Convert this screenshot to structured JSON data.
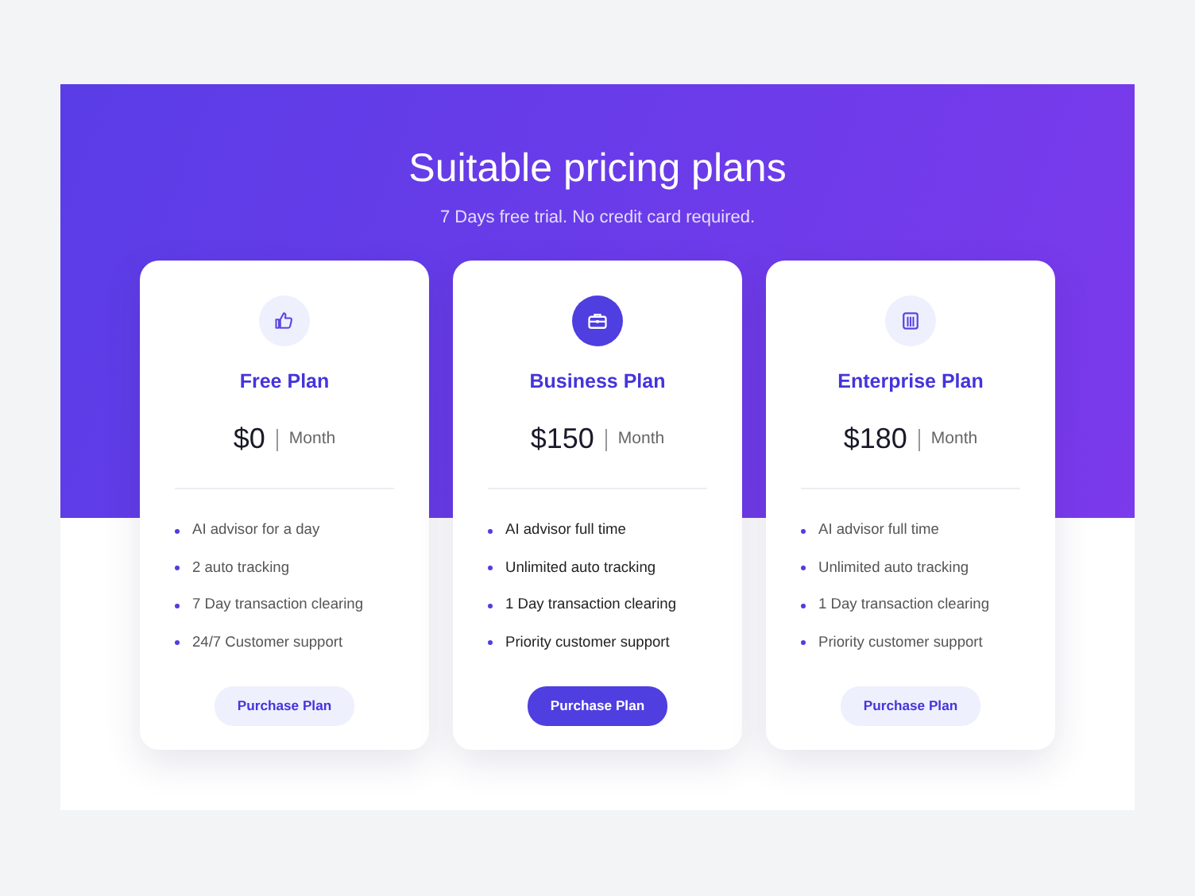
{
  "header": {
    "title": "Suitable pricing plans",
    "subtitle": "7 Days free trial. No credit card required."
  },
  "plans": [
    {
      "kind": "thumb",
      "name": "Free Plan",
      "price": "$0",
      "period": "Month",
      "featured": false,
      "features": [
        "AI advisor for a day",
        "2 auto tracking",
        "7 Day transaction clearing",
        "24/7 Customer support"
      ],
      "button": "Purchase Plan"
    },
    {
      "kind": "briefcase",
      "name": "Business Plan",
      "price": "$150",
      "period": "Month",
      "featured": true,
      "features": [
        "AI advisor full time",
        "Unlimited auto tracking",
        "1 Day transaction clearing",
        "Priority customer support"
      ],
      "button": "Purchase Plan"
    },
    {
      "kind": "building",
      "name": "Enterprise Plan",
      "price": "$180",
      "period": "Month",
      "featured": false,
      "features": [
        "AI advisor full time",
        "Unlimited auto tracking",
        "1 Day transaction clearing",
        "Priority customer support"
      ],
      "button": "Purchase Plan"
    }
  ]
}
